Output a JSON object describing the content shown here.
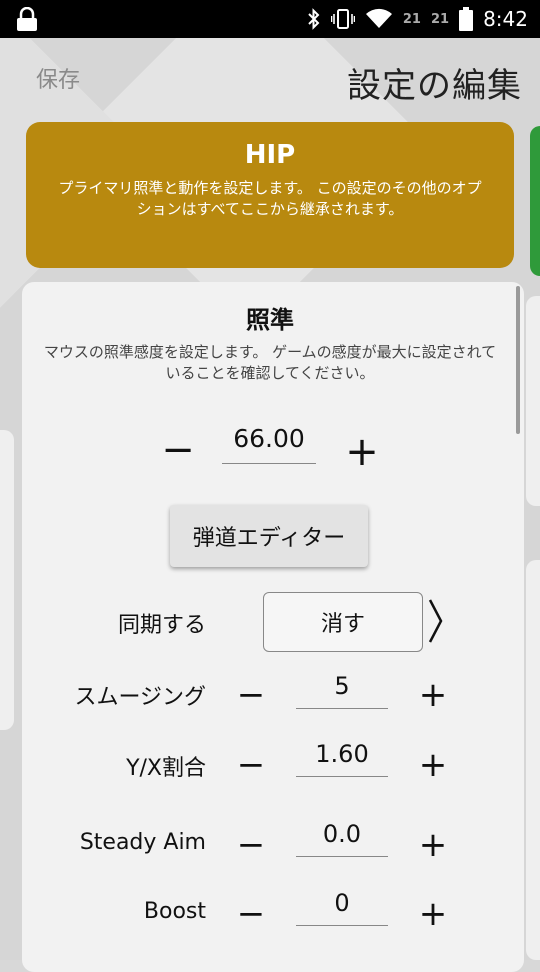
{
  "status_bar": {
    "time": "8:42",
    "sig1": "21",
    "sig2": "21",
    "icons": [
      "lock-icon",
      "bluetooth-icon",
      "vibrate-icon",
      "wifi-icon",
      "signal-icon",
      "battery-icon"
    ]
  },
  "header": {
    "save_label": "保存",
    "title": "設定の編集"
  },
  "hip": {
    "title": "HIP",
    "description": "プライマリ照準と動作を設定します。 この設定のその他のオプションはすべてここから継承されます。",
    "color": "#b8890f"
  },
  "aim": {
    "title": "照準",
    "description": "マウスの照準感度を設定します。 ゲームの感度が最大に設定されていることを確認してください。",
    "minus_label": "−",
    "plus_label": "+",
    "value": "66.00",
    "ballistic_button": "弾道エディター"
  },
  "settings": {
    "sync": {
      "label": "同期する",
      "value": "消す"
    },
    "smoothing": {
      "label": "スムージング",
      "value": "5"
    },
    "yx_ratio": {
      "label": "Y/X割合",
      "value": "1.60"
    },
    "steady_aim": {
      "label": "Steady Aim",
      "value": "0.0"
    },
    "boost": {
      "label": "Boost",
      "value": "0"
    },
    "minus_label": "−",
    "plus_label": "+"
  }
}
